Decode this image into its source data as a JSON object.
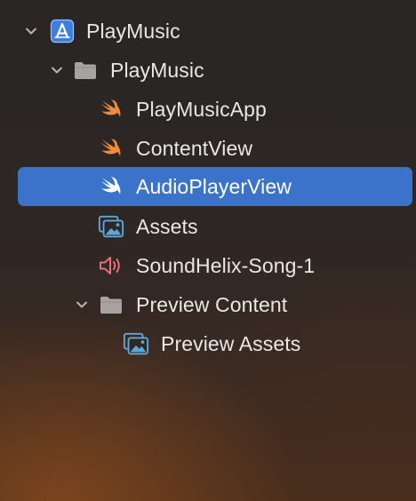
{
  "navigator": {
    "project": {
      "label": "PlayMusic",
      "icon": "xcode-project-icon"
    },
    "group": {
      "label": "PlayMusic",
      "icon": "folder-icon"
    },
    "files": [
      {
        "label": "PlayMusicApp",
        "icon": "swift-file-icon"
      },
      {
        "label": "ContentView",
        "icon": "swift-file-icon"
      },
      {
        "label": "AudioPlayerView",
        "icon": "swift-file-icon",
        "selected": true
      },
      {
        "label": "Assets",
        "icon": "asset-catalog-icon"
      },
      {
        "label": "SoundHelix-Song-1",
        "icon": "audio-file-icon"
      }
    ],
    "preview_group": {
      "label": "Preview Content",
      "icon": "folder-icon"
    },
    "preview_files": [
      {
        "label": "Preview Assets",
        "icon": "asset-catalog-icon"
      }
    ]
  },
  "colors": {
    "selection": "#3a73c9",
    "swift_orange": "#f08a3c",
    "folder_gray": "#a7a3a1",
    "asset_blue": "#5fa7d6",
    "audio_pink": "#e56f7c",
    "xcode_blue": "#3c7ee0"
  }
}
